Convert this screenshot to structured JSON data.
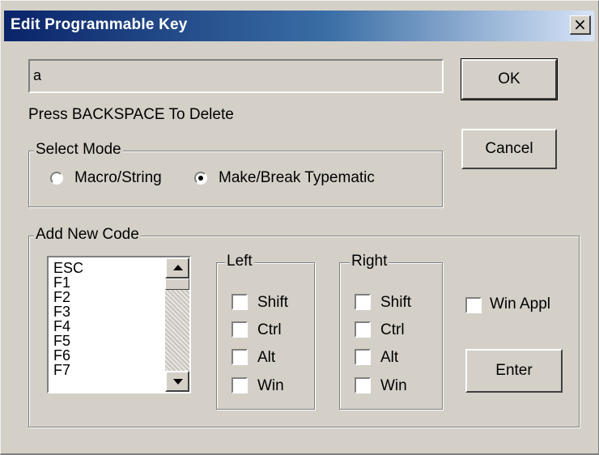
{
  "dialog": {
    "title": "Edit Programmable Key",
    "close_glyph": "×",
    "key_value": "a",
    "hint": "Press BACKSPACE To Delete",
    "ok_label": "OK",
    "cancel_label": "Cancel",
    "enter_label": "Enter"
  },
  "select_mode": {
    "legend": "Select Mode",
    "options": [
      {
        "label": "Macro/String",
        "selected": false
      },
      {
        "label": "Make/Break Typematic",
        "selected": true
      }
    ]
  },
  "add_code": {
    "legend": "Add New Code",
    "list_items": [
      "ESC",
      "F1",
      "F2",
      "F3",
      "F4",
      "F5",
      "F6",
      "F7"
    ],
    "left": {
      "legend": "Left",
      "options": [
        "Shift",
        "Ctrl",
        "Alt",
        "Win"
      ]
    },
    "right": {
      "legend": "Right",
      "options": [
        "Shift",
        "Ctrl",
        "Alt",
        "Win"
      ]
    },
    "win_appl_label": "Win Appl"
  }
}
